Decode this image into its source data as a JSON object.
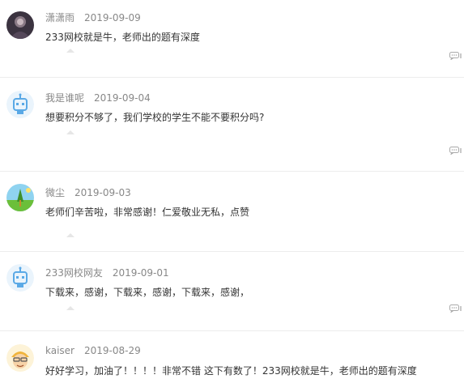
{
  "comments": [
    {
      "user": "潇潇雨",
      "date": "2019-09-09",
      "text": "233网校就是牛，老师出的题有深度",
      "avatar": "dark-photo-avatar-icon"
    },
    {
      "user": "我是谁呢",
      "date": "2019-09-04",
      "text": "想要积分不够了，我们学校的学生不能不要积分吗?",
      "avatar": "robot-avatar-icon"
    },
    {
      "user": "微尘",
      "date": "2019-09-03",
      "text": "老师们辛苦啦，非常感谢！仁爱敬业无私，点赞",
      "avatar": "tree-landscape-avatar-icon"
    },
    {
      "user": "233网校网友",
      "date": "2019-09-01",
      "text": "下载来，感谢，下载来，感谢，下载来，感谢，",
      "avatar": "robot-avatar-icon"
    },
    {
      "user": "kaiser",
      "date": "2019-08-29",
      "text": "好好学习，加油了！！！！非常不错 这下有数了！233网校就是牛，老师出的题有深度",
      "avatar": "cartoon-boy-avatar-icon"
    }
  ],
  "colors": {
    "meta": "#888888",
    "text": "#333333",
    "divider": "#ededed",
    "robot": "#5aa9e6"
  }
}
